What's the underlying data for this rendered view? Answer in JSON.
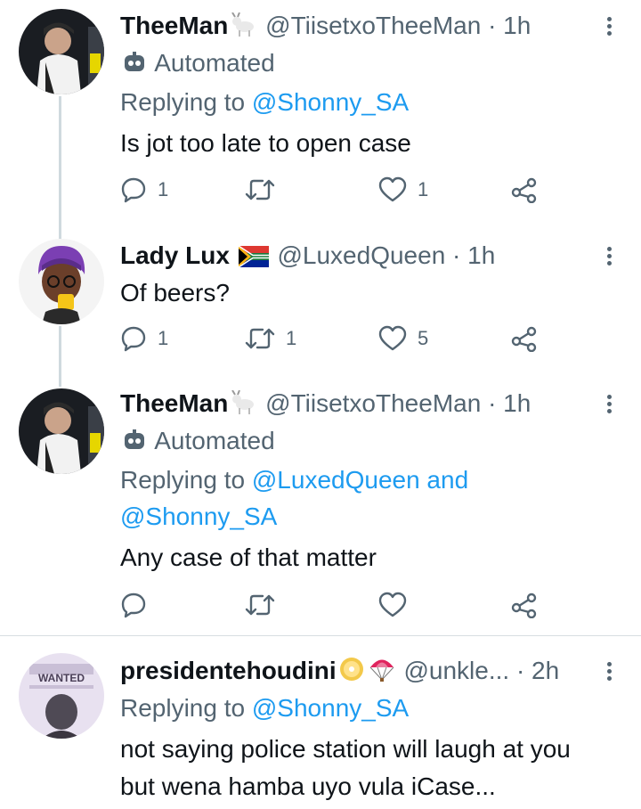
{
  "tweets": [
    {
      "name": "TheeMan",
      "handle": "@TiisetxoTheeMan",
      "time": "· 1h",
      "automated": "Automated",
      "replying_prefix": "Replying to",
      "replying_line1": "@Shonny_SA",
      "text": "Is jot too late to open case",
      "reply_count": "1",
      "retweet_count": "",
      "like_count": "1"
    },
    {
      "name": "Lady Lux",
      "handle": "@LuxedQueen",
      "time": "· 1h",
      "text": "Of beers?",
      "reply_count": "1",
      "retweet_count": "1",
      "like_count": "5"
    },
    {
      "name": "TheeMan",
      "handle": "@TiisetxoTheeMan",
      "time": "· 1h",
      "automated": "Automated",
      "replying_prefix": "Replying to",
      "replying_line1": "@LuxedQueen and",
      "replying_line2": "@Shonny_SA",
      "text": "Any case of that matter",
      "reply_count": "",
      "retweet_count": "",
      "like_count": ""
    },
    {
      "name": "presidentehoudini",
      "handle": "@unkle...",
      "time": "· 2h",
      "replying_prefix": "Replying to",
      "replying_line1": "@Shonny_SA",
      "text_line1": "not saying police station will laugh at you",
      "text_line2": "but wena hamba uyo vula iCase...",
      "avatar_text": "WANTED"
    }
  ],
  "icons": [
    "reply-icon",
    "retweet-icon",
    "like-icon",
    "share-icon",
    "more-icon",
    "robot-icon",
    "goat-emoji-icon",
    "south-africa-flag-icon",
    "dvd-emoji-icon",
    "parachute-emoji-icon"
  ],
  "colors": {
    "link": "#1d9bf0",
    "secondary": "#536471",
    "primary": "#0f1419",
    "thread_line": "#cfd9de"
  }
}
